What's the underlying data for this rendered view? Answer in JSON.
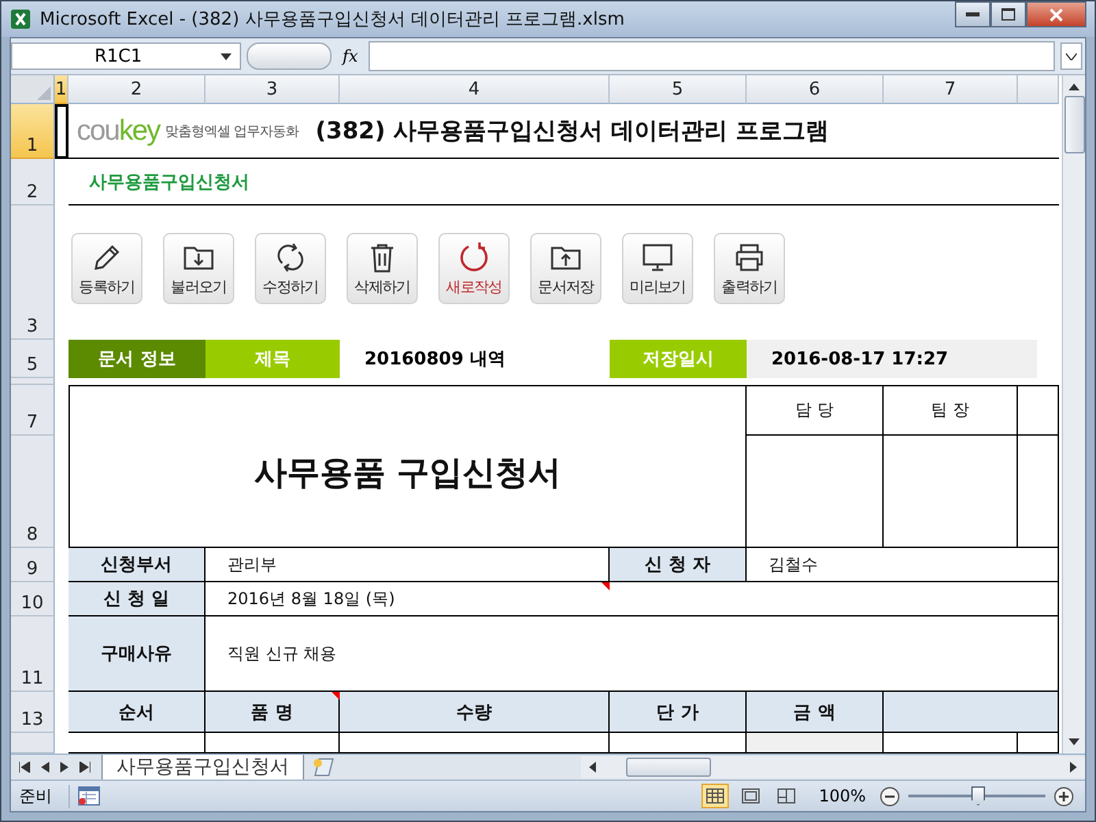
{
  "window": {
    "title": "Microsoft Excel - (382) 사무용품구입신청서 데이터관리 프로그램.xlsm"
  },
  "formula_bar": {
    "name_box": "R1C1",
    "function_label": "fx"
  },
  "column_headers": [
    {
      "label": "1",
      "selected": true
    },
    {
      "label": "2",
      "selected": false
    },
    {
      "label": "3",
      "selected": false
    },
    {
      "label": "4",
      "selected": false
    },
    {
      "label": "5",
      "selected": false
    },
    {
      "label": "6",
      "selected": false
    },
    {
      "label": "7",
      "selected": false
    }
  ],
  "row_headers": [
    {
      "label": "1",
      "selected": true
    },
    {
      "label": "2",
      "selected": false
    },
    {
      "label": "3",
      "selected": false
    },
    {
      "label": "5",
      "selected": false
    },
    {
      "label": "7",
      "selected": false
    },
    {
      "label": "8",
      "selected": false
    },
    {
      "label": "9",
      "selected": false
    },
    {
      "label": "10",
      "selected": false
    },
    {
      "label": "11",
      "selected": false
    },
    {
      "label": "13",
      "selected": false
    }
  ],
  "sheet": {
    "logo": {
      "gray": "cou",
      "green": "key",
      "tagline": "맞춤형엑셀 업무자동화"
    },
    "title": "(382) 사무용품구입신청서 데이터관리 프로그램",
    "subtitle": "사무용품구입신청서",
    "buttons": [
      {
        "label": "등록하기",
        "kind": "pencil",
        "highlighted": false
      },
      {
        "label": "불러오기",
        "kind": "folder-down",
        "highlighted": false
      },
      {
        "label": "수정하기",
        "kind": "refresh",
        "highlighted": false
      },
      {
        "label": "삭제하기",
        "kind": "trash",
        "highlighted": false
      },
      {
        "label": "새로작성",
        "kind": "new",
        "highlighted": true
      },
      {
        "label": "문서저장",
        "kind": "folder-up",
        "highlighted": false
      },
      {
        "label": "미리보기",
        "kind": "monitor",
        "highlighted": false
      },
      {
        "label": "출력하기",
        "kind": "printer",
        "highlighted": false
      }
    ],
    "info_bar": {
      "section": "문서 정보",
      "title_label": "제목",
      "title_value": "20160809 내역",
      "date_label": "저장일시",
      "date_value": "2016-08-17 17:27"
    },
    "form": {
      "heading": "사무용품 구입신청서",
      "approvals": [
        "담 당",
        "팀 장"
      ],
      "department_label": "신청부서",
      "department": "관리부",
      "applicant_label": "신 청 자",
      "applicant": "김철수",
      "date_label": "신 청 일",
      "date": "2016년 8월 18일 (목)",
      "reason_label": "구매사유",
      "reason": "직원 신규 채용",
      "columns": [
        "순서",
        "품 명",
        "수량",
        "단 가",
        "금 액"
      ]
    }
  },
  "sheet_tabs": [
    {
      "label": "사무용품구입신청서",
      "selected": true
    }
  ],
  "status_bar": {
    "mode": "준비",
    "views": [
      {
        "kind": "normal",
        "selected": true
      },
      {
        "kind": "layout",
        "selected": false
      },
      {
        "kind": "pagebreak",
        "selected": false
      }
    ],
    "zoom": "100%",
    "zoom_slider": {
      "level": 0.5
    }
  }
}
